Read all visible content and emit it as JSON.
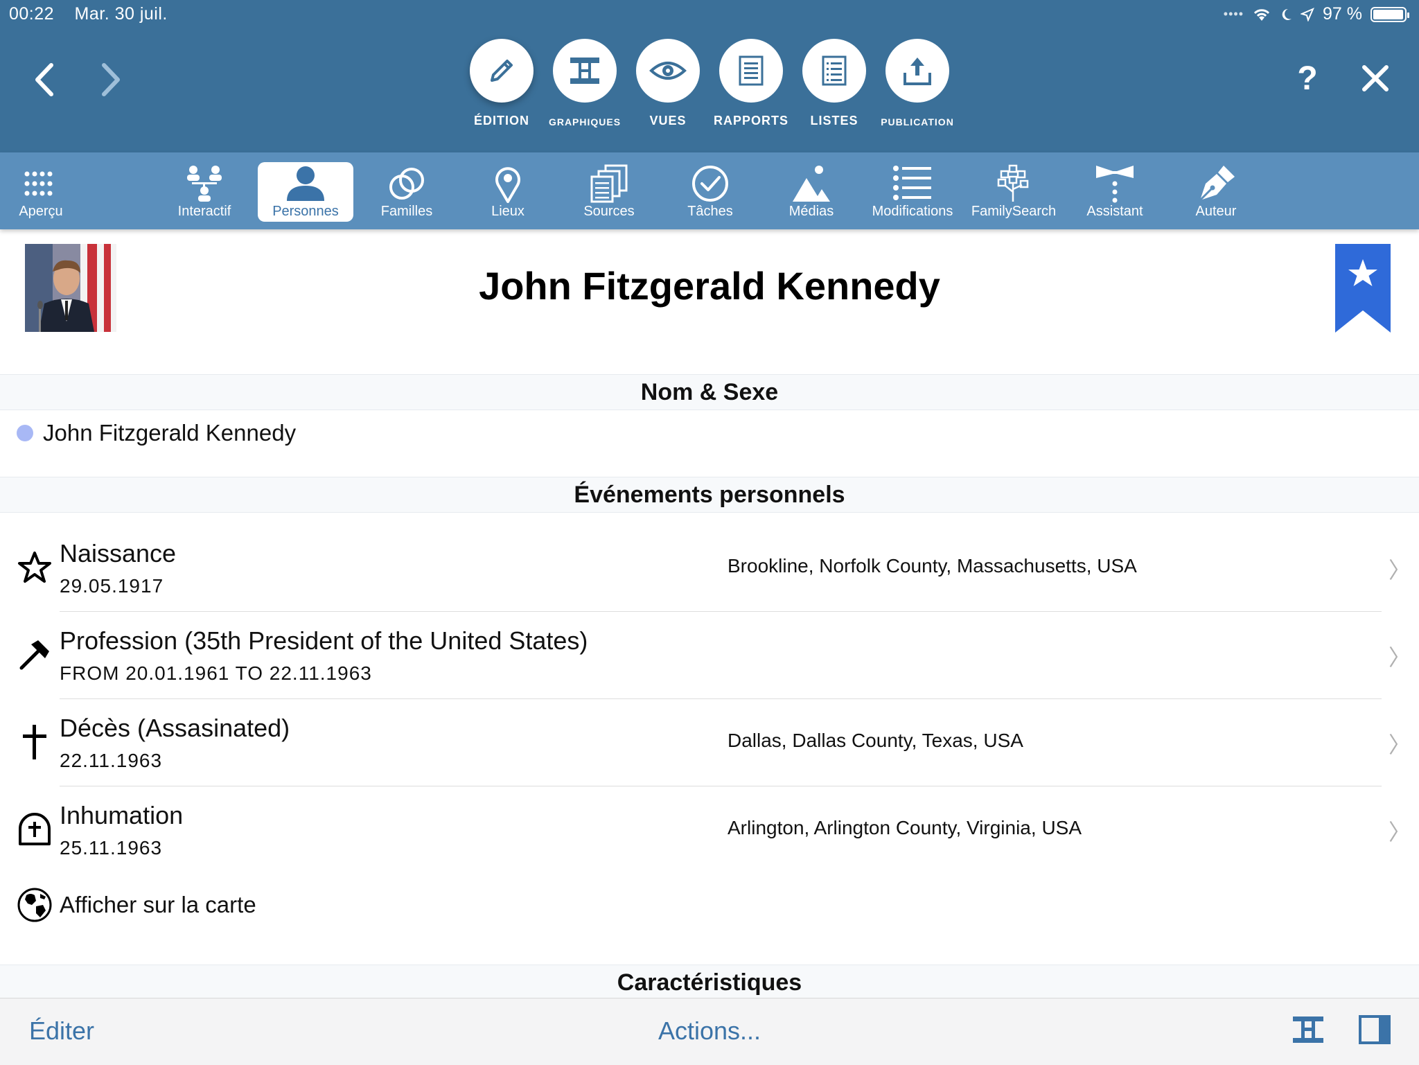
{
  "status": {
    "time": "00:22",
    "date": "Mar. 30 juil.",
    "battery": "97 %",
    "battery_level": 0.97
  },
  "modes": [
    {
      "label": "ÉDITION",
      "icon": "pencil-icon",
      "active": true
    },
    {
      "label": "GRAPHIQUES",
      "icon": "chart-tree-icon"
    },
    {
      "label": "VUES",
      "icon": "eye-icon"
    },
    {
      "label": "RAPPORTS",
      "icon": "report-icon"
    },
    {
      "label": "LISTES",
      "icon": "list-icon"
    },
    {
      "label": "PUBLICATION",
      "icon": "upload-icon"
    }
  ],
  "top_actions": {
    "help": "?",
    "close": "×"
  },
  "tabs": [
    {
      "label": "Aperçu",
      "icon": "grid-icon"
    },
    {
      "label": "Interactif",
      "icon": "interactive-tree-icon"
    },
    {
      "label": "Personnes",
      "icon": "person-icon",
      "active": true
    },
    {
      "label": "Familles",
      "icon": "rings-icon"
    },
    {
      "label": "Lieux",
      "icon": "pin-icon"
    },
    {
      "label": "Sources",
      "icon": "sources-icon"
    },
    {
      "label": "Tâches",
      "icon": "check-icon"
    },
    {
      "label": "Médias",
      "icon": "mountain-icon"
    },
    {
      "label": "Modifications",
      "icon": "list-lines-icon"
    },
    {
      "label": "FamilySearch",
      "icon": "familysearch-tree-icon"
    },
    {
      "label": "Assistant",
      "icon": "bowtie-icon"
    },
    {
      "label": "Auteur",
      "icon": "fountain-pen-icon"
    }
  ],
  "person": {
    "full_name": "John Fitzgerald Kennedy"
  },
  "sections": {
    "name_sex": "Nom & Sexe",
    "events": "Événements personnels",
    "characteristics": "Caractéristiques"
  },
  "name_entry": "John Fitzgerald Kennedy",
  "events": [
    {
      "title": "Naissance",
      "date": "29.05.1917",
      "place": "Brookline, Norfolk County, Massachusetts, USA",
      "icon": "star-icon"
    },
    {
      "title": "Profession (35th President of the United States)",
      "date": "FROM 20.01.1961 TO 22.11.1963",
      "place": "",
      "icon": "hammer-icon"
    },
    {
      "title": "Décès (Assasinated)",
      "date": "22.11.1963",
      "place": "Dallas, Dallas County, Texas, USA",
      "icon": "cross-icon"
    },
    {
      "title": "Inhumation",
      "date": "25.11.1963",
      "place": "Arlington, Arlington County, Virginia, USA",
      "icon": "grave-icon"
    }
  ],
  "map_link": "Afficher sur la carte",
  "bottom": {
    "edit": "Éditer",
    "actions": "Actions..."
  },
  "colors": {
    "toolbar": "#3b7099",
    "subtoolbar": "#5b8fbc",
    "accent": "#3b73a8",
    "bookmark": "#2f6ad9"
  }
}
